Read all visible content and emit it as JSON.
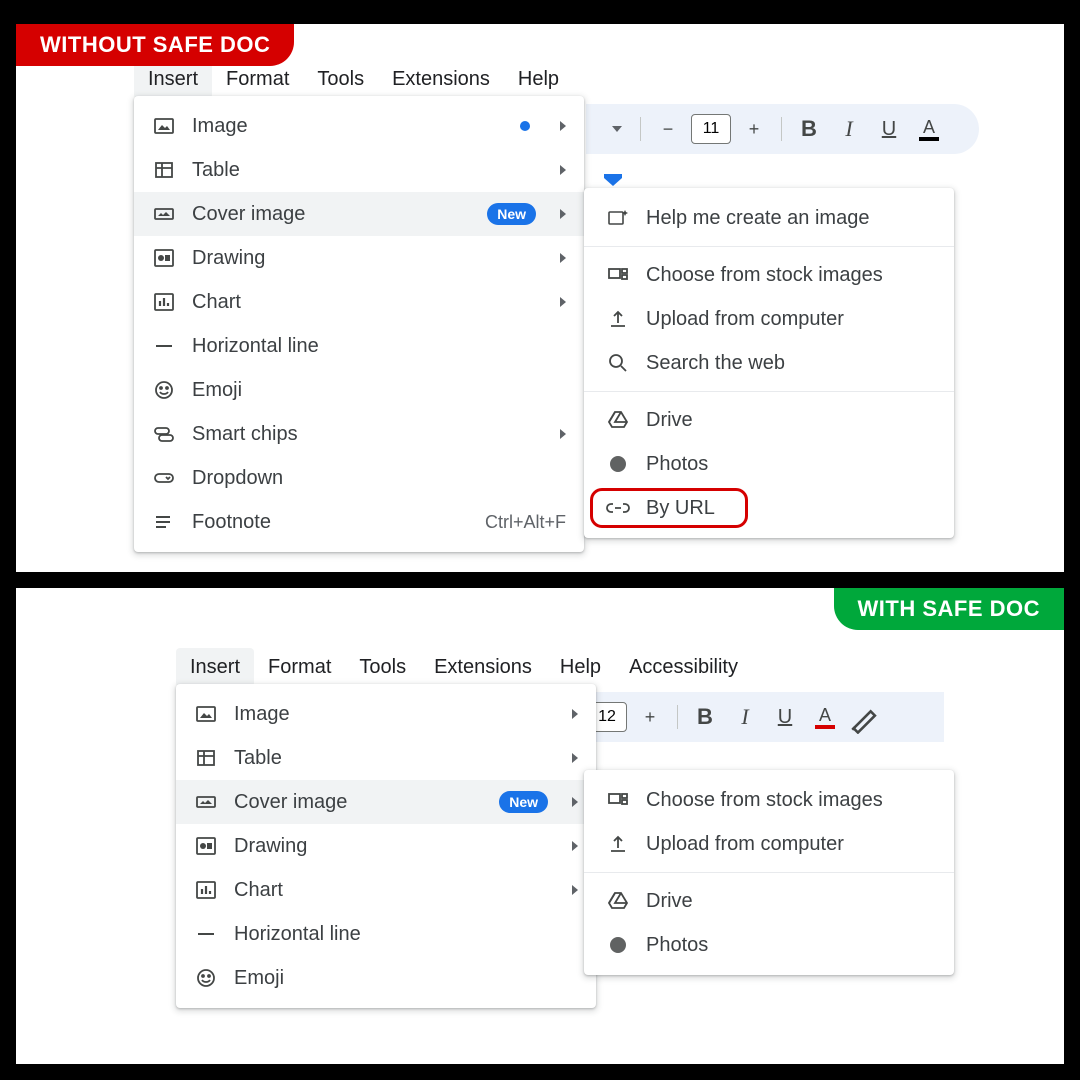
{
  "tags": {
    "without": "WITHOUT SAFE DOC",
    "with": "WITH SAFE DOC"
  },
  "menubar_top": [
    "Insert",
    "Format",
    "Tools",
    "Extensions",
    "Help"
  ],
  "menubar_bot": [
    "Insert",
    "Format",
    "Tools",
    "Extensions",
    "Help",
    "Accessibility"
  ],
  "insert_top": [
    {
      "label": "Image",
      "icon": "image",
      "dot": true,
      "chev": true
    },
    {
      "label": "Table",
      "icon": "table",
      "chev": true
    },
    {
      "label": "Cover image",
      "icon": "cover",
      "new": true,
      "chev": true,
      "hover": true
    },
    {
      "label": "Drawing",
      "icon": "drawing",
      "chev": true
    },
    {
      "label": "Chart",
      "icon": "chart",
      "chev": true
    },
    {
      "label": "Horizontal line",
      "icon": "hline"
    },
    {
      "label": "Emoji",
      "icon": "emoji"
    },
    {
      "label": "Smart chips",
      "icon": "chips",
      "chev": true
    },
    {
      "label": "Dropdown",
      "icon": "dropdown"
    },
    {
      "label": "Footnote",
      "icon": "footnote",
      "shortcut": "Ctrl+Alt+F"
    }
  ],
  "insert_bot": [
    {
      "label": "Image",
      "icon": "image",
      "chev": true
    },
    {
      "label": "Table",
      "icon": "table",
      "chev": true
    },
    {
      "label": "Cover image",
      "icon": "cover",
      "new": true,
      "chev": true,
      "hover": true
    },
    {
      "label": "Drawing",
      "icon": "drawing",
      "chev": true
    },
    {
      "label": "Chart",
      "icon": "chart",
      "chev": true
    },
    {
      "label": "Horizontal line",
      "icon": "hline"
    },
    {
      "label": "Emoji",
      "icon": "emoji"
    }
  ],
  "submenu_top": [
    {
      "label": "Help me create an image",
      "icon": "sparkle"
    },
    {
      "divider": true
    },
    {
      "label": "Choose from stock images",
      "icon": "stock"
    },
    {
      "label": "Upload from computer",
      "icon": "upload"
    },
    {
      "label": "Search the web",
      "icon": "search"
    },
    {
      "divider": true
    },
    {
      "label": "Drive",
      "icon": "drive"
    },
    {
      "label": "Photos",
      "icon": "photos"
    },
    {
      "label": "By URL",
      "icon": "link",
      "highlight": true
    }
  ],
  "submenu_bot": [
    {
      "label": "Choose from stock images",
      "icon": "stock"
    },
    {
      "label": "Upload from computer",
      "icon": "upload"
    },
    {
      "divider": true
    },
    {
      "label": "Drive",
      "icon": "drive"
    },
    {
      "label": "Photos",
      "icon": "photos"
    }
  ],
  "badge_new": "New",
  "toolbar_top": {
    "font_size": "11"
  },
  "toolbar_bot": {
    "font_size": "12"
  }
}
